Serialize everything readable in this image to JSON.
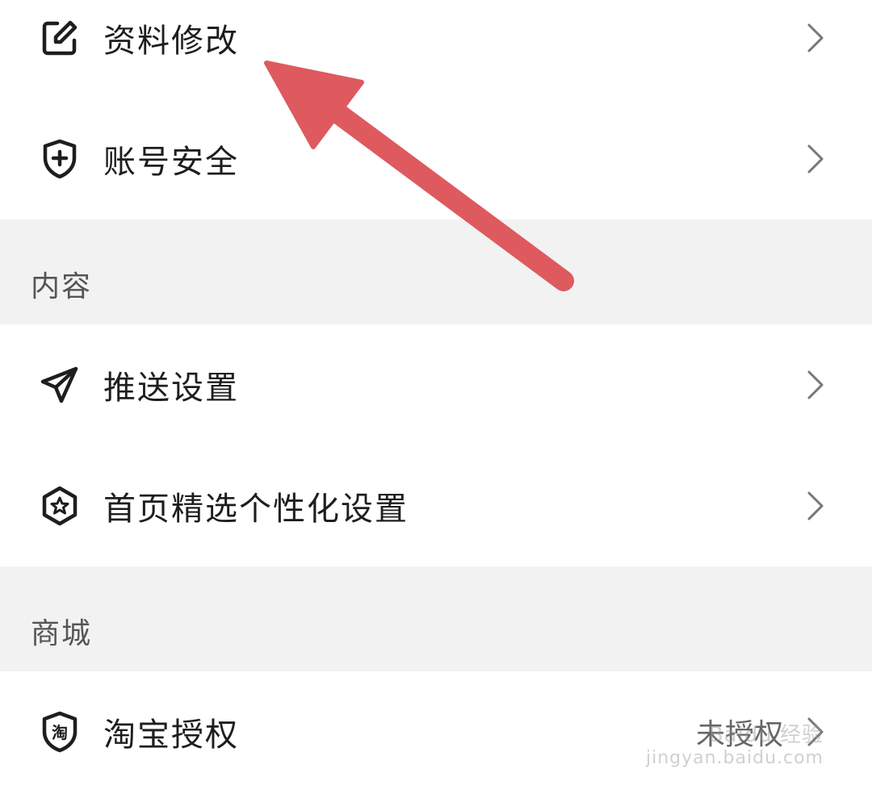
{
  "account": {
    "items": [
      {
        "label": "资料修改",
        "icon": "edit-icon"
      },
      {
        "label": "账号安全",
        "icon": "shield-plus-icon"
      }
    ]
  },
  "content": {
    "section_title": "内容",
    "items": [
      {
        "label": "推送设置",
        "icon": "send-icon"
      },
      {
        "label": "首页精选个性化设置",
        "icon": "star-badge-icon"
      }
    ]
  },
  "mall": {
    "section_title": "商城",
    "items": [
      {
        "label": "淘宝授权",
        "icon": "taobao-shield-icon",
        "status": "未授权",
        "icon_glyph": "淘"
      }
    ]
  },
  "watermark": {
    "text": "jingyan.baidu.com",
    "brand": "Baidu 经验"
  },
  "colors": {
    "annotation_arrow": "#de5a5f",
    "section_bg": "#f2f2f2"
  }
}
